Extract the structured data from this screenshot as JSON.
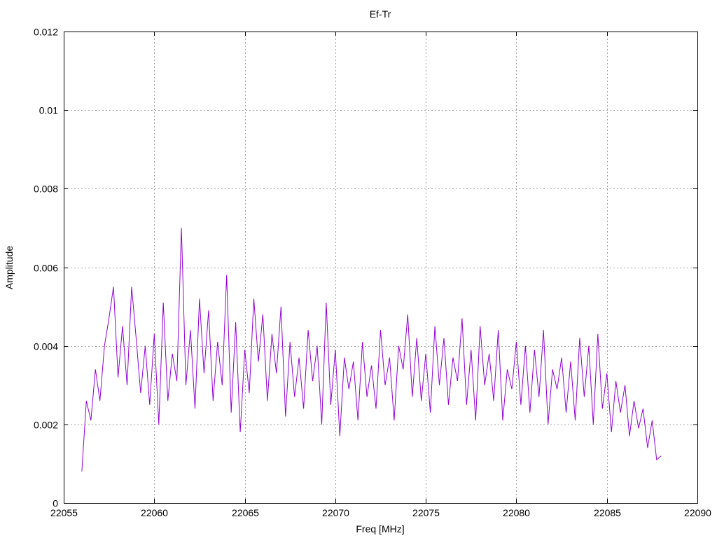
{
  "chart_data": {
    "type": "line",
    "title": "Ef-Tr",
    "xlabel": "Freq [MHz]",
    "ylabel": "Amplitude",
    "xlim": [
      22055,
      22090
    ],
    "ylim": [
      0,
      0.012
    ],
    "x_ticks": [
      22055,
      22060,
      22065,
      22070,
      22075,
      22080,
      22085,
      22090
    ],
    "x_tick_labels": [
      "22055",
      "22060",
      "22065",
      "22070",
      "22075",
      "22080",
      "22085",
      "22090"
    ],
    "y_ticks": [
      0,
      0.002,
      0.004,
      0.006,
      0.008,
      0.01,
      0.012
    ],
    "y_tick_labels": [
      "0",
      "0.002",
      "0.004",
      "0.006",
      "0.008",
      "0.01",
      "0.012"
    ],
    "grid": true,
    "series": [
      {
        "color": "#9400d3",
        "x": [
          22056.0,
          22056.25,
          22056.5,
          22056.75,
          22057.0,
          22057.25,
          22057.5,
          22057.75,
          22058.0,
          22058.25,
          22058.5,
          22058.75,
          22059.0,
          22059.25,
          22059.5,
          22059.75,
          22060.0,
          22060.25,
          22060.5,
          22060.75,
          22061.0,
          22061.25,
          22061.5,
          22061.75,
          22062.0,
          22062.25,
          22062.5,
          22062.75,
          22063.0,
          22063.25,
          22063.5,
          22063.75,
          22064.0,
          22064.25,
          22064.5,
          22064.75,
          22065.0,
          22065.25,
          22065.5,
          22065.75,
          22066.0,
          22066.25,
          22066.5,
          22066.75,
          22067.0,
          22067.25,
          22067.5,
          22067.75,
          22068.0,
          22068.25,
          22068.5,
          22068.75,
          22069.0,
          22069.25,
          22069.5,
          22069.75,
          22070.0,
          22070.25,
          22070.5,
          22070.75,
          22071.0,
          22071.25,
          22071.5,
          22071.75,
          22072.0,
          22072.25,
          22072.5,
          22072.75,
          22073.0,
          22073.25,
          22073.5,
          22073.75,
          22074.0,
          22074.25,
          22074.5,
          22074.75,
          22075.0,
          22075.25,
          22075.5,
          22075.75,
          22076.0,
          22076.25,
          22076.5,
          22076.75,
          22077.0,
          22077.25,
          22077.5,
          22077.75,
          22078.0,
          22078.25,
          22078.5,
          22078.75,
          22079.0,
          22079.25,
          22079.5,
          22079.75,
          22080.0,
          22080.25,
          22080.5,
          22080.75,
          22081.0,
          22081.25,
          22081.5,
          22081.75,
          22082.0,
          22082.25,
          22082.5,
          22082.75,
          22083.0,
          22083.25,
          22083.5,
          22083.75,
          22084.0,
          22084.25,
          22084.5,
          22084.75,
          22085.0,
          22085.25,
          22085.5,
          22085.75,
          22086.0,
          22086.25,
          22086.5,
          22086.75,
          22087.0,
          22087.25,
          22087.5,
          22087.75,
          22088.0
        ],
        "y": [
          0.0008,
          0.0026,
          0.0021,
          0.0034,
          0.0026,
          0.004,
          0.0047,
          0.0055,
          0.0032,
          0.0045,
          0.003,
          0.0055,
          0.0042,
          0.0028,
          0.004,
          0.0025,
          0.0043,
          0.002,
          0.0051,
          0.0026,
          0.0038,
          0.0031,
          0.007,
          0.003,
          0.0044,
          0.0024,
          0.0052,
          0.0033,
          0.0049,
          0.0026,
          0.0041,
          0.003,
          0.0058,
          0.0023,
          0.0046,
          0.0018,
          0.0039,
          0.0028,
          0.0052,
          0.0036,
          0.0048,
          0.0026,
          0.0043,
          0.0033,
          0.005,
          0.0022,
          0.0041,
          0.0027,
          0.0037,
          0.0024,
          0.0044,
          0.0031,
          0.004,
          0.002,
          0.0051,
          0.0025,
          0.0039,
          0.0017,
          0.0037,
          0.0029,
          0.0036,
          0.0021,
          0.0041,
          0.0027,
          0.0035,
          0.0024,
          0.0044,
          0.003,
          0.0037,
          0.0021,
          0.004,
          0.0034,
          0.0048,
          0.0027,
          0.0042,
          0.0026,
          0.0038,
          0.0023,
          0.0045,
          0.003,
          0.0042,
          0.0025,
          0.0037,
          0.0031,
          0.0047,
          0.0025,
          0.0039,
          0.0021,
          0.0045,
          0.003,
          0.0038,
          0.0026,
          0.0044,
          0.0021,
          0.0034,
          0.0029,
          0.0041,
          0.0025,
          0.004,
          0.0023,
          0.0039,
          0.0027,
          0.0044,
          0.002,
          0.0034,
          0.0029,
          0.0037,
          0.0023,
          0.0036,
          0.0021,
          0.0042,
          0.0027,
          0.004,
          0.002,
          0.0043,
          0.0024,
          0.0033,
          0.0018,
          0.0031,
          0.0023,
          0.003,
          0.0017,
          0.0026,
          0.0019,
          0.0024,
          0.0014,
          0.0021,
          0.0011,
          0.0012
        ]
      }
    ]
  }
}
